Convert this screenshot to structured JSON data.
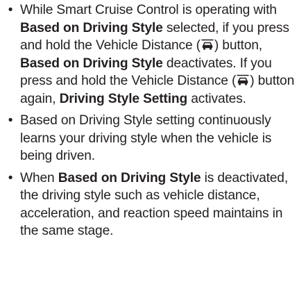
{
  "bullets": [
    {
      "segments": [
        {
          "type": "text",
          "value": "While Smart Cruise Control is operating with "
        },
        {
          "type": "bold",
          "value": "Based on Driving Style"
        },
        {
          "type": "text",
          "value": " selected, if you press and hold the Vehicle Distance ("
        },
        {
          "type": "icon",
          "icon": "vehicle-distance-icon"
        },
        {
          "type": "text",
          "value": ") button, "
        },
        {
          "type": "bold",
          "value": "Based on Driving Style"
        },
        {
          "type": "text",
          "value": " deactivates. If you press and hold the Vehicle Distance ("
        },
        {
          "type": "icon",
          "icon": "vehicle-distance-icon"
        },
        {
          "type": "text",
          "value": ") button again, "
        },
        {
          "type": "bold",
          "value": "Driving Style Setting"
        },
        {
          "type": "text",
          "value": " activates."
        }
      ]
    },
    {
      "segments": [
        {
          "type": "text",
          "value": "Based on Driving Style setting continuously learns your driving style when the vehicle is being driven."
        }
      ]
    },
    {
      "segments": [
        {
          "type": "text",
          "value": "When "
        },
        {
          "type": "bold",
          "value": "Based on Driving Style"
        },
        {
          "type": "text",
          "value": " is deactivated, the driving style such as vehicle distance, acceleration, and reaction speed maintains in the same stage."
        }
      ]
    }
  ],
  "bullet_glyph": "•",
  "text_color": "#231f20"
}
